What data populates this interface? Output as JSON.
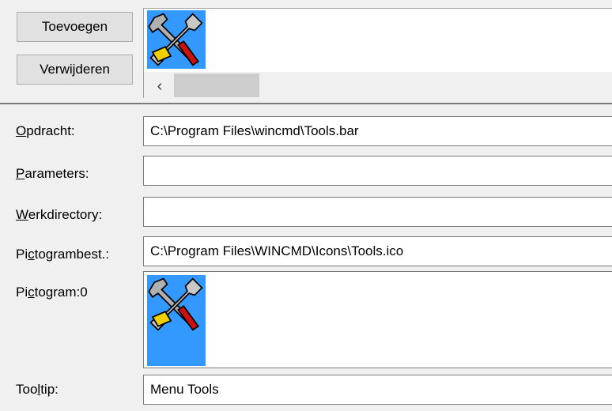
{
  "buttons": {
    "add_label": "Toevoegen",
    "remove_label": "Verwijderen"
  },
  "toolbar_preview": {
    "icon": "tools-icon",
    "scroll_left_glyph": "‹"
  },
  "form": {
    "command": {
      "label_pre": "",
      "label_key": "O",
      "label_post": "pdracht:",
      "value": "C:\\Program Files\\wincmd\\Tools.bar"
    },
    "parameters": {
      "label_pre": "",
      "label_key": "P",
      "label_post": "arameters:",
      "value": ""
    },
    "workdir": {
      "label_pre": "",
      "label_key": "W",
      "label_post": "erkdirectory:",
      "value": ""
    },
    "iconfile": {
      "label_pre": "Pi",
      "label_key": "c",
      "label_post": "togrambest.:",
      "value": "C:\\Program Files\\WINCMD\\Icons\\Tools.ico"
    },
    "icon": {
      "label_pre": "Pi",
      "label_key": "c",
      "label_post": "togram:0",
      "icon": "tools-icon"
    },
    "tooltip": {
      "label_pre": "Too",
      "label_key": "l",
      "label_post": "tip:",
      "value": "Menu Tools"
    }
  },
  "colors": {
    "selection": "#3399ff",
    "background": "#f0f0f0"
  }
}
